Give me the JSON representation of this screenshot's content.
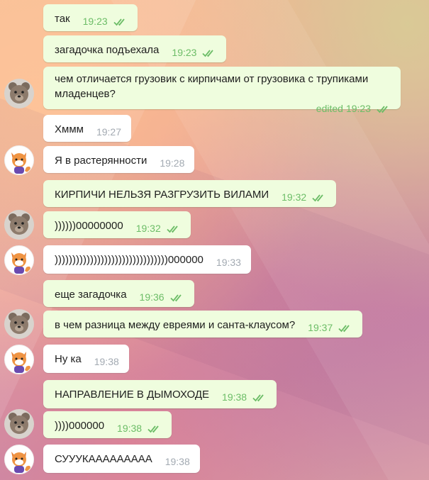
{
  "chat": {
    "messages": [
      {
        "text": "так",
        "time": "19:23",
        "direction": "out",
        "read": true
      },
      {
        "text": "загадочка подъехала",
        "time": "19:23",
        "direction": "out",
        "read": true
      },
      {
        "text": "чем отличается грузовик с кирпичами от грузовика с трупиками младенцев?",
        "time": "19:23",
        "edited_label": "edited",
        "direction": "out",
        "read": true
      },
      {
        "text": "Хммм",
        "time": "19:27",
        "direction": "in"
      },
      {
        "text": "Я в растерянности",
        "time": "19:28",
        "direction": "in"
      },
      {
        "text": "КИРПИЧИ НЕЛЬЗЯ РАЗГРУЗИТЬ ВИЛАМИ",
        "time": "19:32",
        "direction": "out",
        "read": true
      },
      {
        "text": "))))))00000000",
        "time": "19:32",
        "direction": "out",
        "read": true
      },
      {
        "text": "))))))))))))))))))))))))))))))))000000",
        "time": "19:33",
        "direction": "in"
      },
      {
        "text": "еще загадочка",
        "time": "19:36",
        "direction": "out",
        "read": true
      },
      {
        "text": "в чем разница между евреями и санта-клаусом?",
        "time": "19:37",
        "direction": "out",
        "read": true
      },
      {
        "text": "Ну ка",
        "time": "19:38",
        "direction": "in"
      },
      {
        "text": "НАПРАВЛЕНИЕ В ДЫМОХОДЕ",
        "time": "19:38",
        "direction": "out",
        "read": true
      },
      {
        "text": "))))000000",
        "time": "19:38",
        "direction": "out",
        "read": true
      },
      {
        "text": "СУУУКААААААААА",
        "time": "19:38",
        "direction": "in"
      }
    ],
    "avatars": {
      "bear": "bear-avatar",
      "fox": "fox-avatar"
    },
    "colors": {
      "outgoing_bubble": "#effdde",
      "incoming_bubble": "#ffffff",
      "outgoing_meta": "#6cbd67",
      "incoming_meta": "#a3aab2"
    }
  }
}
